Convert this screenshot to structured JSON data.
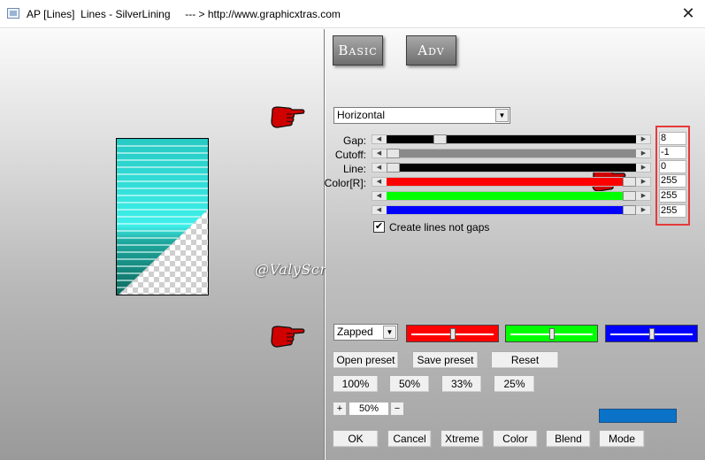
{
  "window": {
    "title": "AP [Lines]  Lines - SilverLining     --- > http://www.graphicxtras.com",
    "close_glyph": "✕"
  },
  "tabs": [
    {
      "label": "Basic"
    },
    {
      "label": "Adv"
    }
  ],
  "direction_select": {
    "value": "Horizontal"
  },
  "sliders": [
    {
      "label": "Gap:",
      "value": "8",
      "color": "#000000",
      "level": 0.2
    },
    {
      "label": "Cutoff:",
      "value": "-1",
      "color": "#8a8a8a",
      "level": 0.0
    },
    {
      "label": "Line:",
      "value": "0",
      "color": "#000000",
      "level": 0.0
    },
    {
      "label": "Color[R]:",
      "value": "255",
      "color": "#ff0000",
      "level": 1.0
    },
    {
      "label": "",
      "value": "255",
      "color": "#00ff00",
      "level": 1.0
    },
    {
      "label": "",
      "value": "255",
      "color": "#0000ff",
      "level": 1.0
    }
  ],
  "checkbox": {
    "label": "Create lines not gaps",
    "checked": true,
    "mark": "✔"
  },
  "mode_select": {
    "value": "Zapped"
  },
  "swatches": [
    {
      "color": "#ff0000",
      "level": 0.5
    },
    {
      "color": "#00ff00",
      "level": 0.5
    },
    {
      "color": "#0000ff",
      "level": 0.5
    }
  ],
  "buttons": {
    "open_preset": "Open preset",
    "save_preset": "Save preset",
    "reset": "Reset",
    "zoom_100": "100%",
    "zoom_50": "50%",
    "zoom_33": "33%",
    "zoom_25": "25%"
  },
  "zoom": {
    "plus": "+",
    "minus": "−",
    "value": "50%"
  },
  "bottom_buttons": [
    {
      "label": "OK"
    },
    {
      "label": "Cancel"
    },
    {
      "label": "Xtreme"
    },
    {
      "label": "Color"
    },
    {
      "label": "Blend"
    },
    {
      "label": "Mode"
    }
  ],
  "current_color": "#0a73c8",
  "watermark": "@ValyScrapPassion",
  "icons": [
    "app-icon",
    "close-icon",
    "dropdown-arrow-icon",
    "pointing-hand-icon"
  ]
}
